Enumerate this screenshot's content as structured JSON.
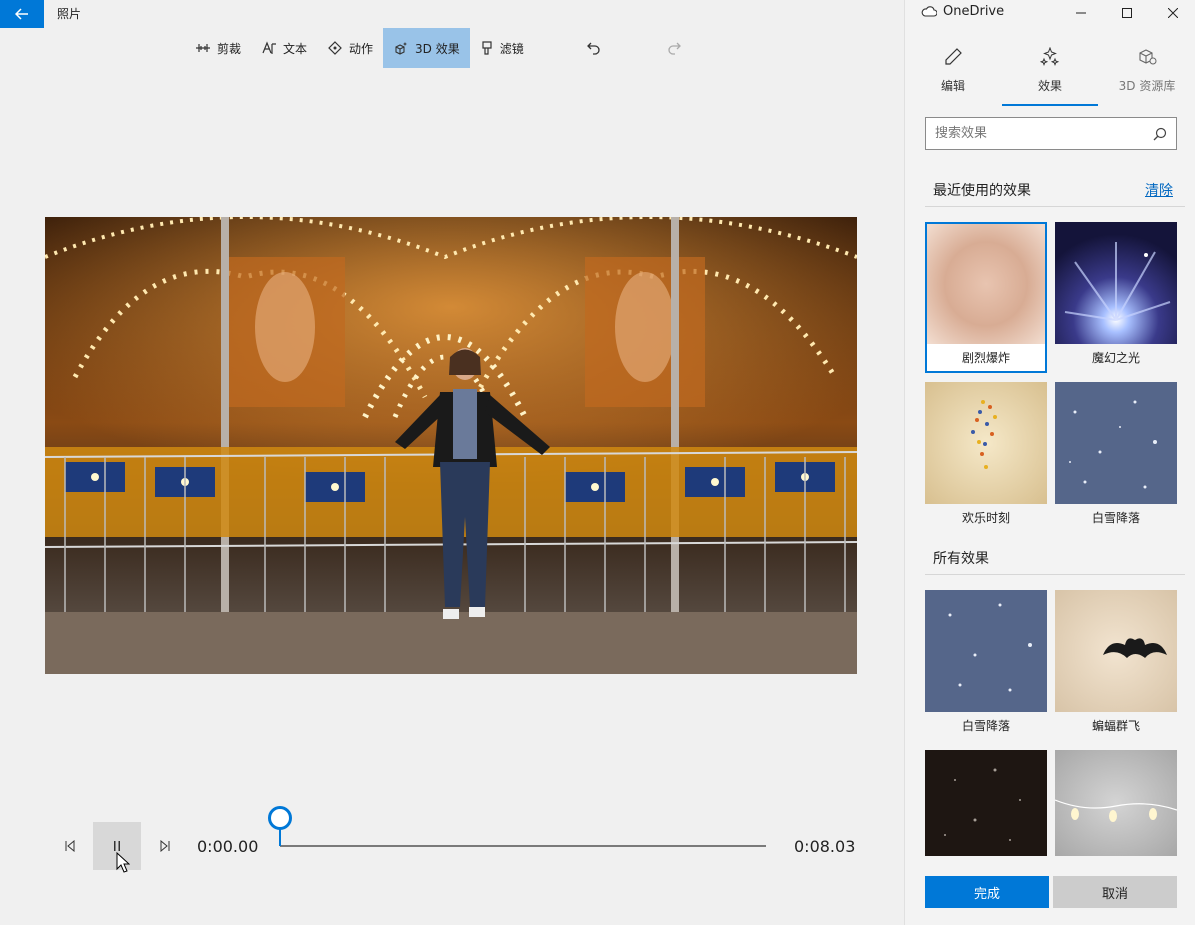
{
  "app": {
    "title": "照片"
  },
  "toolbar": {
    "items": [
      {
        "label": "剪裁",
        "icon": "trim-icon"
      },
      {
        "label": "文本",
        "icon": "text-icon"
      },
      {
        "label": "动作",
        "icon": "motion-icon"
      },
      {
        "label": "3D 效果",
        "icon": "3d-effects-icon",
        "active": true
      },
      {
        "label": "滤镜",
        "icon": "filter-icon"
      }
    ],
    "undo_icon": "undo-icon",
    "redo_icon": "redo-icon"
  },
  "player": {
    "current_time": "0:00.00",
    "end_time": "0:08.03",
    "progress": 0.0
  },
  "titlebar": {
    "cloud_label": "OneDrive"
  },
  "panel": {
    "tabs": [
      {
        "label": "编辑",
        "icon": "pencil-icon"
      },
      {
        "label": "效果",
        "icon": "sparkle-icon",
        "active": true
      },
      {
        "label": "3D 资源库",
        "icon": "3d-library-icon"
      }
    ],
    "search": {
      "placeholder": "搜索效果"
    },
    "recent": {
      "title": "最近使用的效果",
      "clear_label": "清除",
      "items": [
        {
          "label": "剧烈爆炸",
          "selected": true
        },
        {
          "label": "魔幻之光"
        },
        {
          "label": "欢乐时刻"
        },
        {
          "label": "白雪降落"
        }
      ]
    },
    "all": {
      "title": "所有效果",
      "items": [
        {
          "label": "白雪降落"
        },
        {
          "label": "蝙蝠群飞"
        },
        {
          "label": ""
        },
        {
          "label": ""
        }
      ]
    },
    "done_label": "完成",
    "cancel_label": "取消"
  },
  "colors": {
    "accent": "#0078d7",
    "active_tool": "#99c3e8"
  }
}
